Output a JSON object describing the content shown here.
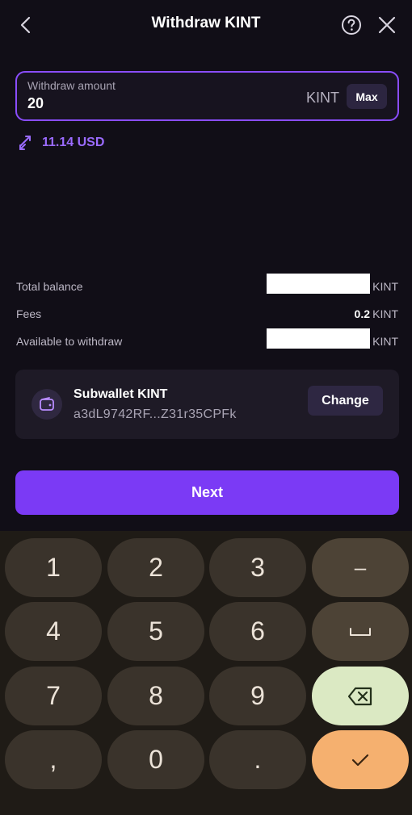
{
  "header": {
    "title": "Withdraw KINT",
    "back_icon": "chevron-left-icon",
    "help_icon": "help-circle-icon",
    "close_icon": "close-icon"
  },
  "amount": {
    "label": "Withdraw amount",
    "value": "20",
    "unit": "KINT",
    "max_label": "Max"
  },
  "usd_value": "11.14 USD",
  "info": {
    "total_balance_label": "Total balance",
    "total_balance_unit": "KINT",
    "fees_label": "Fees",
    "fees_value": "0.2",
    "fees_unit": "KINT",
    "available_label": "Available to withdraw",
    "available_unit": "KINT"
  },
  "wallet": {
    "name": "Subwallet KINT",
    "address": "a3dL9742RF...Z31r35CPFk",
    "change_label": "Change"
  },
  "next_label": "Next",
  "keyboard": {
    "keys": [
      "1",
      "2",
      "3",
      "–",
      "4",
      "5",
      "6",
      "␣",
      "7",
      "8",
      "9",
      "⌫",
      ",",
      "0",
      ".",
      "✓"
    ]
  },
  "colors": {
    "accent": "#7b3af5",
    "accent_text": "#9b6bff",
    "background": "#110e17",
    "card": "#1e1a26",
    "key_backspace": "#dbe9c3",
    "key_enter": "#f5b06f"
  }
}
